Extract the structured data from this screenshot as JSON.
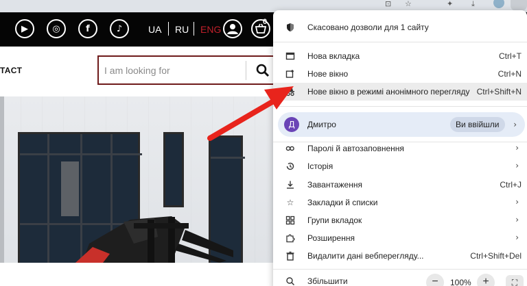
{
  "browser": {
    "icons": [
      "translate-icon",
      "star-icon",
      "puzzle-icon",
      "download-icon"
    ],
    "colors": {
      "toolbar": "#dfe3e8"
    }
  },
  "site": {
    "social": [
      {
        "name": "youtube-icon",
        "glyph": "▶"
      },
      {
        "name": "instagram-icon",
        "glyph": "◎"
      },
      {
        "name": "facebook-icon",
        "glyph": "f"
      },
      {
        "name": "tiktok-icon",
        "glyph": "♪"
      }
    ],
    "languages": [
      {
        "label": "UA",
        "active": false
      },
      {
        "label": "RU",
        "active": false
      },
      {
        "label": "ENG",
        "active": true
      }
    ],
    "cart_count": "0",
    "nav_contact": "TACT",
    "search": {
      "placeholder": "I am looking for"
    },
    "colors": {
      "header": "#050505",
      "accent": "#c0202a",
      "search_border": "#6e1a1a"
    }
  },
  "menu": {
    "permissions": "Скасовано дозволи для 1 сайту",
    "group1": [
      {
        "icon": "new-tab-icon",
        "label": "Нова вкладка",
        "shortcut": "Ctrl+T"
      },
      {
        "icon": "new-window-icon",
        "label": "Нове вікно",
        "shortcut": "Ctrl+N"
      },
      {
        "icon": "incognito-icon",
        "label": "Нове вікно в режимі анонімного перегляду",
        "shortcut": "Ctrl+Shift+N"
      }
    ],
    "profile": {
      "initial": "Д",
      "name": "Дмитро",
      "status": "Ви ввійшли"
    },
    "group2": [
      {
        "icon": "key-icon",
        "label": "Паролі й автозаповнення",
        "shortcut": ""
      },
      {
        "icon": "history-icon",
        "label": "Історія",
        "shortcut": ""
      },
      {
        "icon": "download-icon",
        "label": "Завантаження",
        "shortcut": "Ctrl+J"
      },
      {
        "icon": "bookmark-star-icon",
        "label": "Закладки й списки",
        "shortcut": ""
      },
      {
        "icon": "tab-groups-icon",
        "label": "Групи вкладок",
        "shortcut": ""
      },
      {
        "icon": "extensions-icon",
        "label": "Розширення",
        "shortcut": ""
      },
      {
        "icon": "trash-icon",
        "label": "Видалити дані веб­перегляду...",
        "shortcut": "Ctrl+Shift+Del"
      }
    ],
    "zoom": {
      "label": "Збільшити",
      "value": "100%"
    },
    "colors": {
      "highlight": "#ececec",
      "profile_bg": "#e5ecf7",
      "avatar": "#6a44b6"
    }
  },
  "annotation": {
    "color": "#e8241c"
  }
}
